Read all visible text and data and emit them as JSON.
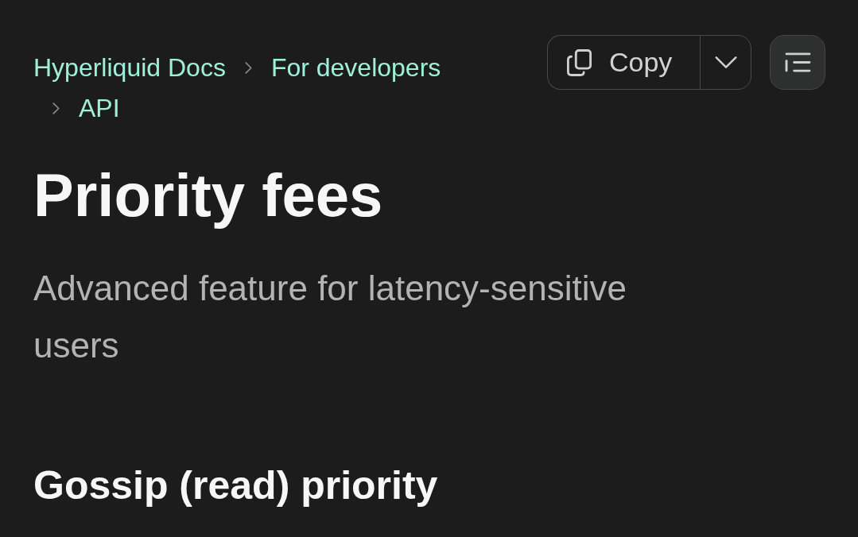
{
  "breadcrumbs": [
    {
      "label": "Hyperliquid Docs"
    },
    {
      "label": "For developers"
    },
    {
      "label": "API"
    }
  ],
  "toolbar": {
    "copy_button": {
      "label": "Copy"
    }
  },
  "page": {
    "title": "Priority fees",
    "subtitle": "Advanced feature for latency-sensitive users"
  },
  "sections": [
    {
      "heading": "Gossip (read) priority"
    }
  ]
}
